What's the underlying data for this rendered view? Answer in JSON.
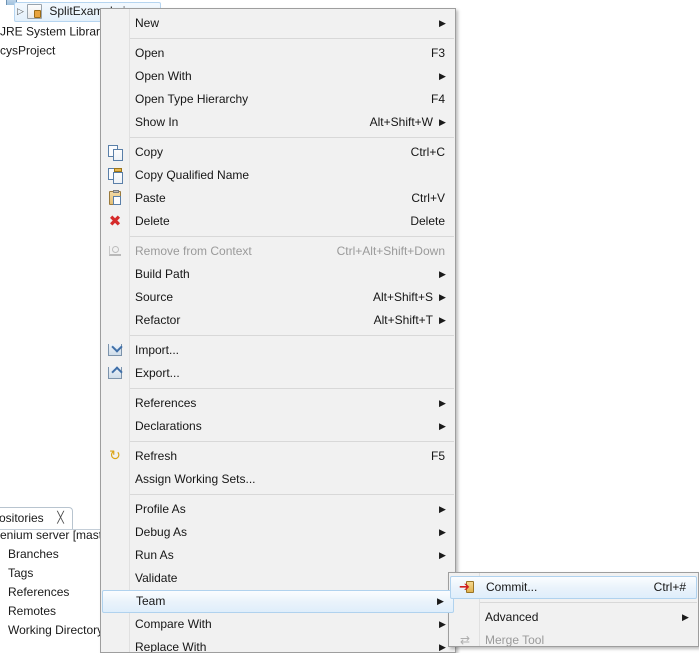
{
  "background": {
    "package_explorer": {
      "cut_top_row": "",
      "rows": [
        {
          "label": "SplitExample.java",
          "icon": "java-file-icon",
          "selected": true,
          "twisty": "▷"
        },
        {
          "label": "JRE System Library",
          "icon": "library-icon",
          "selected": false,
          "twisty": ""
        },
        {
          "label": "cysProject",
          "icon": "project-icon",
          "selected": false,
          "twisty": ""
        }
      ]
    },
    "git_repositories_view": {
      "tab_label": "ositories",
      "tab_close_icon": "close-icon",
      "repo_label": "enium server [mast",
      "items": [
        {
          "label": "Branches"
        },
        {
          "label": "Tags"
        },
        {
          "label": "References"
        },
        {
          "label": "Remotes"
        },
        {
          "label": "Working Directory"
        }
      ]
    }
  },
  "context_menu": {
    "groups": [
      {
        "items": [
          {
            "label": "New",
            "accel": "",
            "arrow": true,
            "icon": "",
            "disabled": false
          }
        ]
      },
      {
        "items": [
          {
            "label": "Open",
            "accel": "F3",
            "arrow": false,
            "icon": "",
            "disabled": false
          },
          {
            "label": "Open With",
            "accel": "",
            "arrow": true,
            "icon": "",
            "disabled": false
          },
          {
            "label": "Open Type Hierarchy",
            "accel": "F4",
            "arrow": false,
            "icon": "",
            "disabled": false
          },
          {
            "label": "Show In",
            "accel": "Alt+Shift+W",
            "arrow": true,
            "icon": "",
            "disabled": false
          }
        ]
      },
      {
        "items": [
          {
            "label": "Copy",
            "accel": "Ctrl+C",
            "arrow": false,
            "icon": "copy-icon",
            "disabled": false
          },
          {
            "label": "Copy Qualified Name",
            "accel": "",
            "arrow": false,
            "icon": "copy-qualified-name-icon",
            "disabled": false
          },
          {
            "label": "Paste",
            "accel": "Ctrl+V",
            "arrow": false,
            "icon": "paste-icon",
            "disabled": false
          },
          {
            "label": "Delete",
            "accel": "Delete",
            "arrow": false,
            "icon": "delete-icon",
            "disabled": false
          }
        ]
      },
      {
        "items": [
          {
            "label": "Remove from Context",
            "accel": "Ctrl+Alt+Shift+Down",
            "arrow": false,
            "icon": "remove-from-context-icon",
            "disabled": true
          },
          {
            "label": "Build Path",
            "accel": "",
            "arrow": true,
            "icon": "",
            "disabled": false
          },
          {
            "label": "Source",
            "accel": "Alt+Shift+S",
            "arrow": true,
            "icon": "",
            "disabled": false
          },
          {
            "label": "Refactor",
            "accel": "Alt+Shift+T",
            "arrow": true,
            "icon": "",
            "disabled": false
          }
        ]
      },
      {
        "items": [
          {
            "label": "Import...",
            "accel": "",
            "arrow": false,
            "icon": "import-icon",
            "disabled": false
          },
          {
            "label": "Export...",
            "accel": "",
            "arrow": false,
            "icon": "export-icon",
            "disabled": false
          }
        ]
      },
      {
        "items": [
          {
            "label": "References",
            "accel": "",
            "arrow": true,
            "icon": "",
            "disabled": false
          },
          {
            "label": "Declarations",
            "accel": "",
            "arrow": true,
            "icon": "",
            "disabled": false
          }
        ]
      },
      {
        "items": [
          {
            "label": "Refresh",
            "accel": "F5",
            "arrow": false,
            "icon": "refresh-icon",
            "disabled": false
          },
          {
            "label": "Assign Working Sets...",
            "accel": "",
            "arrow": false,
            "icon": "",
            "disabled": false
          }
        ]
      },
      {
        "items": [
          {
            "label": "Profile As",
            "accel": "",
            "arrow": true,
            "icon": "",
            "disabled": false
          },
          {
            "label": "Debug As",
            "accel": "",
            "arrow": true,
            "icon": "",
            "disabled": false
          },
          {
            "label": "Run As",
            "accel": "",
            "arrow": true,
            "icon": "",
            "disabled": false
          },
          {
            "label": "Validate",
            "accel": "",
            "arrow": false,
            "icon": "",
            "disabled": false
          },
          {
            "label": "Team",
            "accel": "",
            "arrow": true,
            "icon": "",
            "disabled": false,
            "selected": true
          },
          {
            "label": "Compare With",
            "accel": "",
            "arrow": true,
            "icon": "",
            "disabled": false
          },
          {
            "label": "Replace With",
            "accel": "",
            "arrow": true,
            "icon": "",
            "disabled": false
          }
        ]
      }
    ]
  },
  "team_submenu": {
    "groups": [
      {
        "items": [
          {
            "label": "Commit...",
            "accel": "Ctrl+#",
            "arrow": false,
            "icon": "commit-icon",
            "disabled": false,
            "selected": true
          }
        ]
      },
      {
        "items": [
          {
            "label": "Advanced",
            "accel": "",
            "arrow": true,
            "icon": "",
            "disabled": false
          },
          {
            "label": "Merge Tool",
            "accel": "",
            "arrow": false,
            "icon": "merge-tool-icon",
            "disabled": true
          }
        ]
      }
    ]
  },
  "colors": {
    "menu_background": "#f1f1f1",
    "menu_border": "#9e9e9e",
    "selection_border": "#b0d2ee",
    "disabled_text": "#9a9a9a",
    "text": "#161616",
    "delete_icon": "#d52b2b",
    "refresh_icon": "#dba417"
  }
}
